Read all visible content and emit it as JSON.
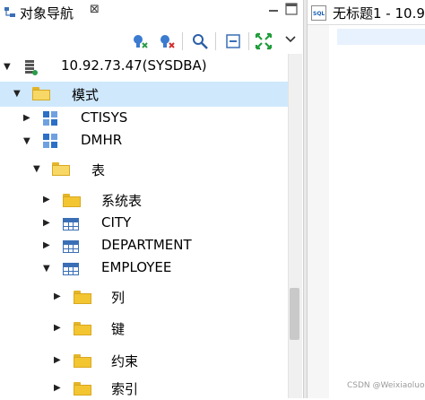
{
  "panel": {
    "title": "对象导航",
    "close_glyph": "⊠"
  },
  "toolbar": {
    "icons": [
      "connect-icon",
      "disconnect-icon",
      "search-icon",
      "collapse-icon",
      "expand-icon",
      "view-menu-icon"
    ]
  },
  "tree": {
    "connection": "10.92.73.47(SYSDBA)",
    "schema_folder": "模式",
    "schemas": [
      "CTISYS",
      "DMHR"
    ],
    "tables_folder": "表",
    "tables": [
      "系统表",
      "CITY",
      "DEPARTMENT",
      "EMPLOYEE"
    ],
    "employee_children": [
      "列",
      "键",
      "约束",
      "索引"
    ]
  },
  "editor": {
    "tab_title": "无标题1 - 10.9",
    "sql_badge": "SQL"
  },
  "watermark": "CSDN @Weixiaoluo123",
  "colors": {
    "selection": "#cfe8fc",
    "folder": "#f3c531",
    "schema_blue": "#2b6fc6",
    "expand_green": "#1f9d3a"
  }
}
